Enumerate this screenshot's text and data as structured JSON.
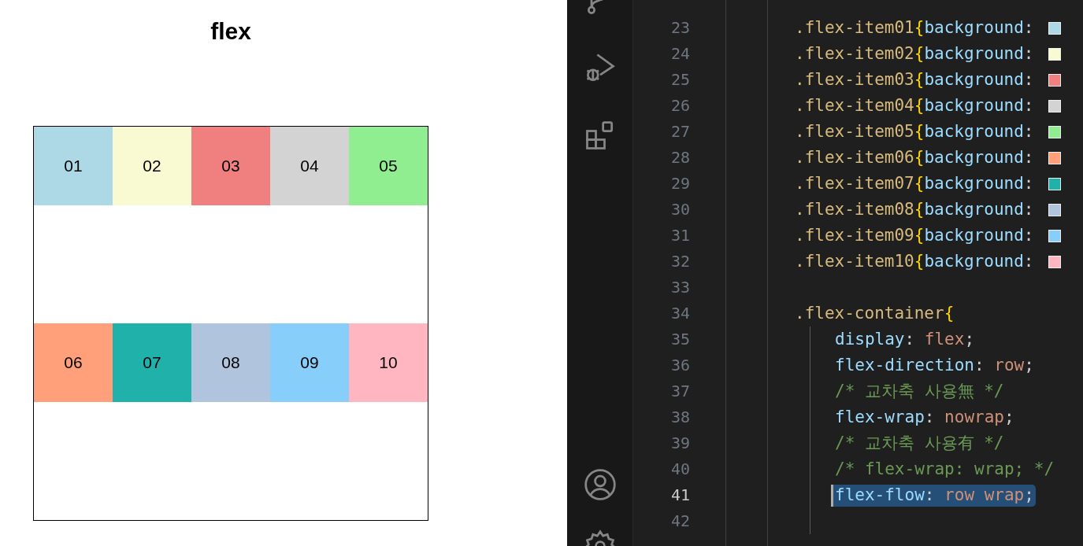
{
  "preview": {
    "title": "flex",
    "items": [
      {
        "label": "01",
        "color": "#add8e6"
      },
      {
        "label": "02",
        "color": "#fafad2"
      },
      {
        "label": "03",
        "color": "#f08080"
      },
      {
        "label": "04",
        "color": "#d3d3d3"
      },
      {
        "label": "05",
        "color": "#90ee90"
      },
      {
        "label": "06",
        "color": "#ffa07a"
      },
      {
        "label": "07",
        "color": "#20b2aa"
      },
      {
        "label": "08",
        "color": "#b0c4de"
      },
      {
        "label": "09",
        "color": "#87cefa"
      },
      {
        "label": "10",
        "color": "#ffb6c1"
      }
    ]
  },
  "editor": {
    "lines": [
      {
        "number": "23",
        "kind": "rule",
        "current": false,
        "tokens": [
          {
            "kind": "selector",
            "text": ".flex-item01"
          },
          {
            "kind": "brace",
            "text": "{"
          },
          {
            "kind": "property",
            "text": "background"
          },
          {
            "kind": "punct",
            "text": ": "
          }
        ],
        "color": "#add8e6"
      },
      {
        "number": "24",
        "kind": "rule",
        "current": false,
        "tokens": [
          {
            "kind": "selector",
            "text": ".flex-item02"
          },
          {
            "kind": "brace",
            "text": "{"
          },
          {
            "kind": "property",
            "text": "background"
          },
          {
            "kind": "punct",
            "text": ": "
          }
        ],
        "color": "#fafad2"
      },
      {
        "number": "25",
        "kind": "rule",
        "current": false,
        "tokens": [
          {
            "kind": "selector",
            "text": ".flex-item03"
          },
          {
            "kind": "brace",
            "text": "{"
          },
          {
            "kind": "property",
            "text": "background"
          },
          {
            "kind": "punct",
            "text": ": "
          }
        ],
        "color": "#f08080"
      },
      {
        "number": "26",
        "kind": "rule",
        "current": false,
        "tokens": [
          {
            "kind": "selector",
            "text": ".flex-item04"
          },
          {
            "kind": "brace",
            "text": "{"
          },
          {
            "kind": "property",
            "text": "background"
          },
          {
            "kind": "punct",
            "text": ": "
          }
        ],
        "color": "#d3d3d3"
      },
      {
        "number": "27",
        "kind": "rule",
        "current": false,
        "tokens": [
          {
            "kind": "selector",
            "text": ".flex-item05"
          },
          {
            "kind": "brace",
            "text": "{"
          },
          {
            "kind": "property",
            "text": "background"
          },
          {
            "kind": "punct",
            "text": ": "
          }
        ],
        "color": "#90ee90"
      },
      {
        "number": "28",
        "kind": "rule",
        "current": false,
        "tokens": [
          {
            "kind": "selector",
            "text": ".flex-item06"
          },
          {
            "kind": "brace",
            "text": "{"
          },
          {
            "kind": "property",
            "text": "background"
          },
          {
            "kind": "punct",
            "text": ": "
          }
        ],
        "color": "#ffa07a"
      },
      {
        "number": "29",
        "kind": "rule",
        "current": false,
        "tokens": [
          {
            "kind": "selector",
            "text": ".flex-item07"
          },
          {
            "kind": "brace",
            "text": "{"
          },
          {
            "kind": "property",
            "text": "background"
          },
          {
            "kind": "punct",
            "text": ": "
          }
        ],
        "color": "#20b2aa"
      },
      {
        "number": "30",
        "kind": "rule",
        "current": false,
        "tokens": [
          {
            "kind": "selector",
            "text": ".flex-item08"
          },
          {
            "kind": "brace",
            "text": "{"
          },
          {
            "kind": "property",
            "text": "background"
          },
          {
            "kind": "punct",
            "text": ": "
          }
        ],
        "color": "#b0c4de"
      },
      {
        "number": "31",
        "kind": "rule",
        "current": false,
        "tokens": [
          {
            "kind": "selector",
            "text": ".flex-item09"
          },
          {
            "kind": "brace",
            "text": "{"
          },
          {
            "kind": "property",
            "text": "background"
          },
          {
            "kind": "punct",
            "text": ": "
          }
        ],
        "color": "#87cefa"
      },
      {
        "number": "32",
        "kind": "rule",
        "current": false,
        "tokens": [
          {
            "kind": "selector",
            "text": ".flex-item10"
          },
          {
            "kind": "brace",
            "text": "{"
          },
          {
            "kind": "property",
            "text": "background"
          },
          {
            "kind": "punct",
            "text": ": "
          }
        ],
        "color": "#ffb6c1"
      },
      {
        "number": "33",
        "kind": "blank",
        "current": false
      },
      {
        "number": "34",
        "kind": "rule",
        "current": false,
        "tokens": [
          {
            "kind": "selector",
            "text": ".flex-container"
          },
          {
            "kind": "brace",
            "text": "{"
          }
        ]
      },
      {
        "number": "35",
        "kind": "decl",
        "current": false,
        "tokens": [
          {
            "kind": "property",
            "text": "display"
          },
          {
            "kind": "punct",
            "text": ": "
          },
          {
            "kind": "value",
            "text": "flex"
          },
          {
            "kind": "punct",
            "text": ";"
          }
        ]
      },
      {
        "number": "36",
        "kind": "decl",
        "current": false,
        "tokens": [
          {
            "kind": "property",
            "text": "flex-direction"
          },
          {
            "kind": "punct",
            "text": ": "
          },
          {
            "kind": "value",
            "text": "row"
          },
          {
            "kind": "punct",
            "text": ";"
          }
        ]
      },
      {
        "number": "37",
        "kind": "decl",
        "current": false,
        "tokens": [
          {
            "kind": "comment",
            "text": "/* 교차축 사용無 */"
          }
        ]
      },
      {
        "number": "38",
        "kind": "decl",
        "current": false,
        "tokens": [
          {
            "kind": "property",
            "text": "flex-wrap"
          },
          {
            "kind": "punct",
            "text": ": "
          },
          {
            "kind": "value",
            "text": "nowrap"
          },
          {
            "kind": "punct",
            "text": ";"
          }
        ]
      },
      {
        "number": "39",
        "kind": "decl",
        "current": false,
        "tokens": [
          {
            "kind": "comment",
            "text": "/* 교차축 사용有 */"
          }
        ]
      },
      {
        "number": "40",
        "kind": "decl",
        "current": false,
        "tokens": [
          {
            "kind": "comment",
            "text": "/* flex-wrap: wrap; */"
          }
        ]
      },
      {
        "number": "41",
        "kind": "decl",
        "current": true,
        "tokens": [
          {
            "kind": "property",
            "text": "flex-flow"
          },
          {
            "kind": "punct",
            "text": ": "
          },
          {
            "kind": "value",
            "text": "row wrap"
          },
          {
            "kind": "punct",
            "text": ";"
          }
        ]
      },
      {
        "number": "42",
        "kind": "decl",
        "current": false
      }
    ]
  }
}
